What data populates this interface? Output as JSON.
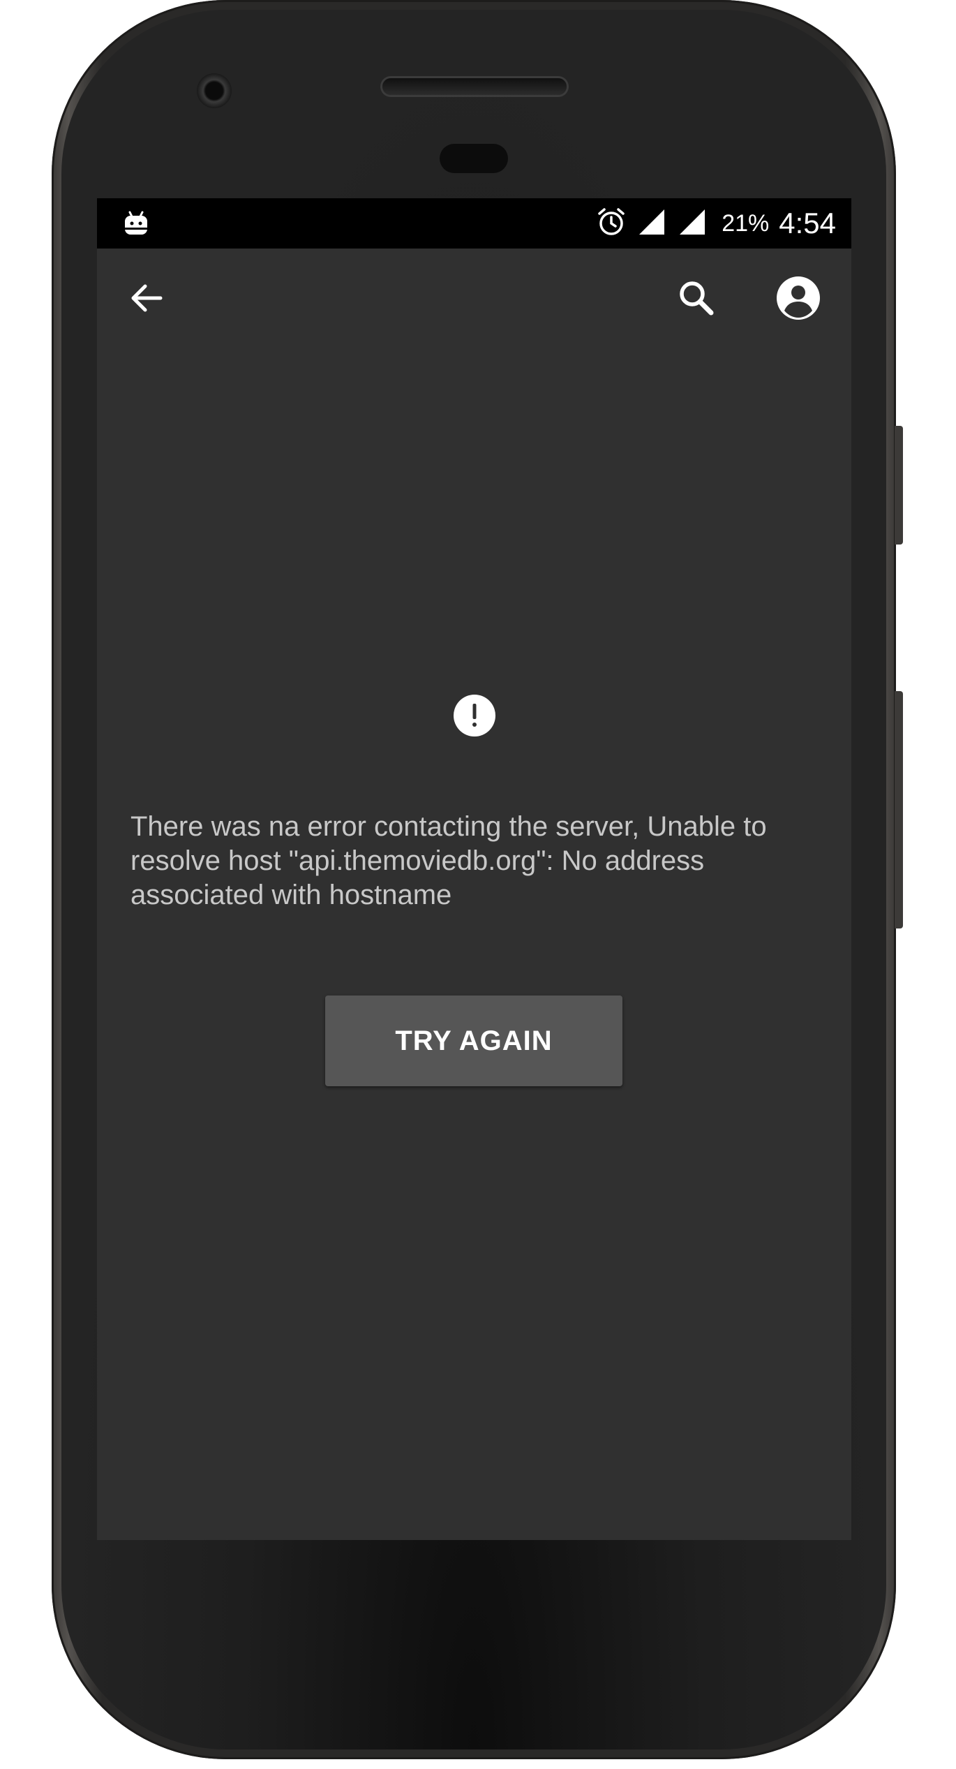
{
  "status_bar": {
    "notification_icon": "android-icon",
    "alarm_icon": "alarm-clock-icon",
    "signal_icons": [
      "wifi-signal-icon",
      "cell-signal-icon"
    ],
    "battery": "21%",
    "time": "4:54"
  },
  "toolbar": {
    "back_icon": "arrow-back-icon",
    "search_icon": "search-icon",
    "account_icon": "account-circle-icon"
  },
  "error": {
    "icon": "error-circle-icon",
    "message": "There was na error contacting the server, Unable to resolve host \"api.themoviedb.org\": No address associated with hostname",
    "retry_label": "TRY AGAIN"
  },
  "colors": {
    "screen_background": "#303030",
    "button_background": "#565656",
    "text_secondary": "#c8c8c8"
  }
}
